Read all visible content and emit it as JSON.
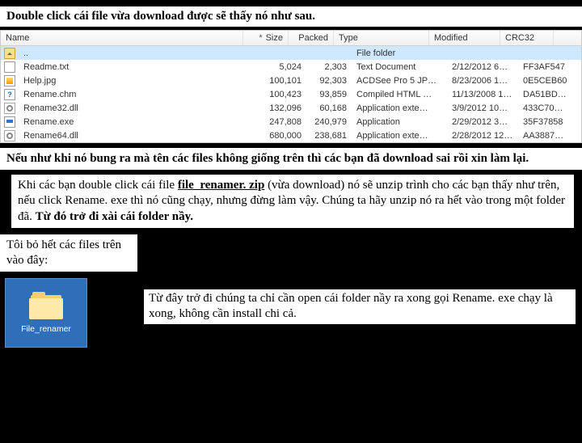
{
  "instr1": "Double click cái file vừa download được sẽ thấy nó như sau.",
  "explorer": {
    "headers": {
      "name": "Name",
      "size": "Size",
      "packed": "Packed",
      "type": "Type",
      "modified": "Modified",
      "crc": "CRC32",
      "sort_marker": "*"
    },
    "rows": [
      {
        "name": "..",
        "size": "",
        "packed": "",
        "type": "File folder",
        "modified": "",
        "crc": "",
        "icon": "updir",
        "selected": true
      },
      {
        "name": "Readme.txt",
        "size": "5,024",
        "packed": "2,303",
        "type": "Text Document",
        "modified": "2/12/2012 6…",
        "crc": "FF3AF547",
        "icon": "txt"
      },
      {
        "name": "Help.jpg",
        "size": "100,101",
        "packed": "92,303",
        "type": "ACDSee Pro 5 JP…",
        "modified": "8/23/2006 1…",
        "crc": "0E5CEB60",
        "icon": "jpg"
      },
      {
        "name": "Rename.chm",
        "size": "100,423",
        "packed": "93,859",
        "type": "Compiled HTML …",
        "modified": "11/13/2008 1…",
        "crc": "DA51BD…",
        "icon": "chm"
      },
      {
        "name": "Rename32.dll",
        "size": "132,096",
        "packed": "60,168",
        "type": "Application exte…",
        "modified": "3/9/2012 10…",
        "crc": "433C70…",
        "icon": "dll"
      },
      {
        "name": "Rename.exe",
        "size": "247,808",
        "packed": "240,979",
        "type": "Application",
        "modified": "2/29/2012 3…",
        "crc": "35F37858",
        "icon": "exe"
      },
      {
        "name": "Rename64.dll",
        "size": "680,000",
        "packed": "238,681",
        "type": "Application exte…",
        "modified": "2/28/2012 12…",
        "crc": "AA3887…",
        "icon": "dll"
      }
    ]
  },
  "instr2": "Nếu như khi nó bung ra mà tên các files không giống trên thì các bạn đã download sai rồi xin làm lại.",
  "instr3": {
    "pre": "Khi các bạn double click cái file ",
    "link": "file_renamer. zip",
    "post1": " (vừa download) nó sẽ unzip trình cho các bạn thấy như trên, nếu click Rename. exe thì nó cũng chạy, nhưng đừng làm vậy. Chúng ta hãy unzip nó ra hết vào trong một folder đã. ",
    "bold_tail": "Từ đó trở đi xài cái folder nầy."
  },
  "instr4": "Tôi bỏ hết các files trên vào đây:",
  "thumb_label": "File_renamer",
  "instr5": "Từ đây trở đi chúng ta chỉ cần open cái folder nầy ra xong gọi Rename. exe chạy là xong, không cần install chi cả."
}
